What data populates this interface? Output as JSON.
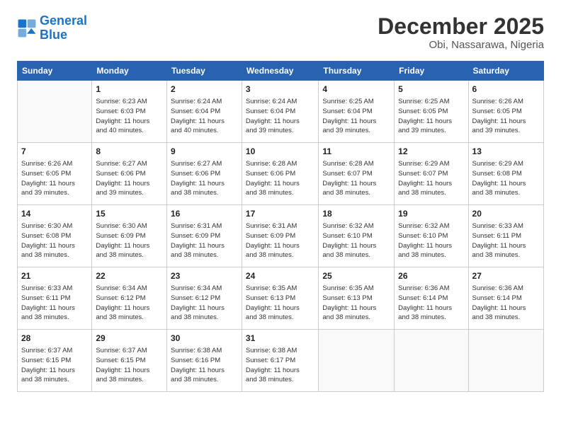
{
  "logo": {
    "text_general": "General",
    "text_blue": "Blue"
  },
  "header": {
    "title": "December 2025",
    "subtitle": "Obi, Nassarawa, Nigeria"
  },
  "days_of_week": [
    "Sunday",
    "Monday",
    "Tuesday",
    "Wednesday",
    "Thursday",
    "Friday",
    "Saturday"
  ],
  "weeks": [
    [
      {
        "day": "",
        "info": ""
      },
      {
        "day": "1",
        "info": "Sunrise: 6:23 AM\nSunset: 6:03 PM\nDaylight: 11 hours\nand 40 minutes."
      },
      {
        "day": "2",
        "info": "Sunrise: 6:24 AM\nSunset: 6:04 PM\nDaylight: 11 hours\nand 40 minutes."
      },
      {
        "day": "3",
        "info": "Sunrise: 6:24 AM\nSunset: 6:04 PM\nDaylight: 11 hours\nand 39 minutes."
      },
      {
        "day": "4",
        "info": "Sunrise: 6:25 AM\nSunset: 6:04 PM\nDaylight: 11 hours\nand 39 minutes."
      },
      {
        "day": "5",
        "info": "Sunrise: 6:25 AM\nSunset: 6:05 PM\nDaylight: 11 hours\nand 39 minutes."
      },
      {
        "day": "6",
        "info": "Sunrise: 6:26 AM\nSunset: 6:05 PM\nDaylight: 11 hours\nand 39 minutes."
      }
    ],
    [
      {
        "day": "7",
        "info": "Sunrise: 6:26 AM\nSunset: 6:05 PM\nDaylight: 11 hours\nand 39 minutes."
      },
      {
        "day": "8",
        "info": "Sunrise: 6:27 AM\nSunset: 6:06 PM\nDaylight: 11 hours\nand 39 minutes."
      },
      {
        "day": "9",
        "info": "Sunrise: 6:27 AM\nSunset: 6:06 PM\nDaylight: 11 hours\nand 38 minutes."
      },
      {
        "day": "10",
        "info": "Sunrise: 6:28 AM\nSunset: 6:06 PM\nDaylight: 11 hours\nand 38 minutes."
      },
      {
        "day": "11",
        "info": "Sunrise: 6:28 AM\nSunset: 6:07 PM\nDaylight: 11 hours\nand 38 minutes."
      },
      {
        "day": "12",
        "info": "Sunrise: 6:29 AM\nSunset: 6:07 PM\nDaylight: 11 hours\nand 38 minutes."
      },
      {
        "day": "13",
        "info": "Sunrise: 6:29 AM\nSunset: 6:08 PM\nDaylight: 11 hours\nand 38 minutes."
      }
    ],
    [
      {
        "day": "14",
        "info": "Sunrise: 6:30 AM\nSunset: 6:08 PM\nDaylight: 11 hours\nand 38 minutes."
      },
      {
        "day": "15",
        "info": "Sunrise: 6:30 AM\nSunset: 6:09 PM\nDaylight: 11 hours\nand 38 minutes."
      },
      {
        "day": "16",
        "info": "Sunrise: 6:31 AM\nSunset: 6:09 PM\nDaylight: 11 hours\nand 38 minutes."
      },
      {
        "day": "17",
        "info": "Sunrise: 6:31 AM\nSunset: 6:09 PM\nDaylight: 11 hours\nand 38 minutes."
      },
      {
        "day": "18",
        "info": "Sunrise: 6:32 AM\nSunset: 6:10 PM\nDaylight: 11 hours\nand 38 minutes."
      },
      {
        "day": "19",
        "info": "Sunrise: 6:32 AM\nSunset: 6:10 PM\nDaylight: 11 hours\nand 38 minutes."
      },
      {
        "day": "20",
        "info": "Sunrise: 6:33 AM\nSunset: 6:11 PM\nDaylight: 11 hours\nand 38 minutes."
      }
    ],
    [
      {
        "day": "21",
        "info": "Sunrise: 6:33 AM\nSunset: 6:11 PM\nDaylight: 11 hours\nand 38 minutes."
      },
      {
        "day": "22",
        "info": "Sunrise: 6:34 AM\nSunset: 6:12 PM\nDaylight: 11 hours\nand 38 minutes."
      },
      {
        "day": "23",
        "info": "Sunrise: 6:34 AM\nSunset: 6:12 PM\nDaylight: 11 hours\nand 38 minutes."
      },
      {
        "day": "24",
        "info": "Sunrise: 6:35 AM\nSunset: 6:13 PM\nDaylight: 11 hours\nand 38 minutes."
      },
      {
        "day": "25",
        "info": "Sunrise: 6:35 AM\nSunset: 6:13 PM\nDaylight: 11 hours\nand 38 minutes."
      },
      {
        "day": "26",
        "info": "Sunrise: 6:36 AM\nSunset: 6:14 PM\nDaylight: 11 hours\nand 38 minutes."
      },
      {
        "day": "27",
        "info": "Sunrise: 6:36 AM\nSunset: 6:14 PM\nDaylight: 11 hours\nand 38 minutes."
      }
    ],
    [
      {
        "day": "28",
        "info": "Sunrise: 6:37 AM\nSunset: 6:15 PM\nDaylight: 11 hours\nand 38 minutes."
      },
      {
        "day": "29",
        "info": "Sunrise: 6:37 AM\nSunset: 6:15 PM\nDaylight: 11 hours\nand 38 minutes."
      },
      {
        "day": "30",
        "info": "Sunrise: 6:38 AM\nSunset: 6:16 PM\nDaylight: 11 hours\nand 38 minutes."
      },
      {
        "day": "31",
        "info": "Sunrise: 6:38 AM\nSunset: 6:17 PM\nDaylight: 11 hours\nand 38 minutes."
      },
      {
        "day": "",
        "info": ""
      },
      {
        "day": "",
        "info": ""
      },
      {
        "day": "",
        "info": ""
      }
    ]
  ]
}
